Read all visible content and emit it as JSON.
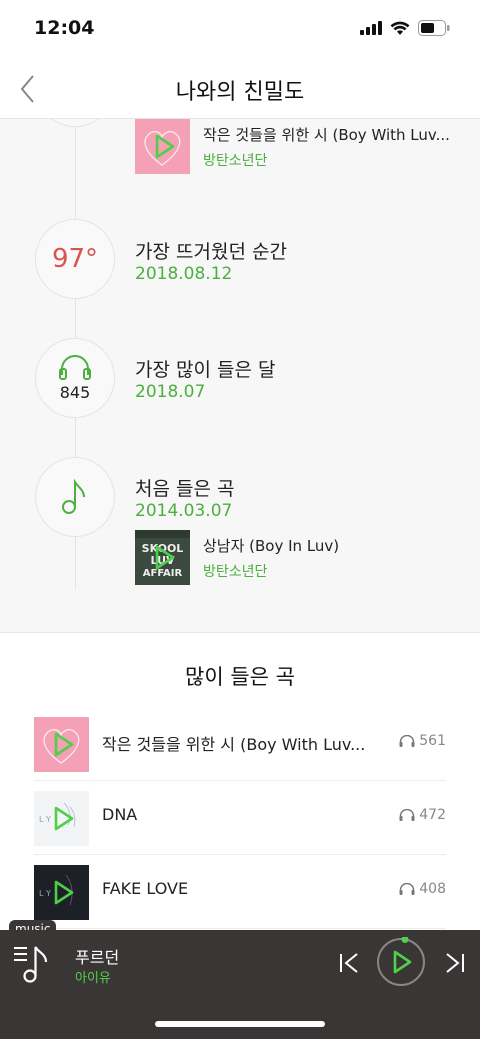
{
  "status": {
    "time": "12:04"
  },
  "header": {
    "title": "나와의 친밀도"
  },
  "timeline": {
    "top_song": {
      "title": "작은 것들을 위한 시 (Boy With Luv...",
      "artist": "방탄소년단"
    },
    "hottest": {
      "degree": "97°",
      "label": "가장 뜨거웠던 순간",
      "date": "2018.08.12"
    },
    "most_month": {
      "count": "845",
      "label": "가장 많이 들은 달",
      "date": "2018.07"
    },
    "first_song": {
      "label": "처음 들은 곡",
      "date": "2014.03.07",
      "song_title": "상남자 (Boy In Luv)",
      "song_artist": "방탄소년단",
      "album_art_text": "SKOOL LUV AFFAIR"
    }
  },
  "most_played": {
    "title": "많이 들은 곡",
    "songs": [
      {
        "title": "작은 것들을 위한 시 (Boy With Luv...",
        "plays": "561"
      },
      {
        "title": "DNA",
        "plays": "472"
      },
      {
        "title": "FAKE LOVE",
        "plays": "408"
      }
    ]
  },
  "player": {
    "tag": "music",
    "title": "푸르던",
    "artist": "아이유"
  },
  "colors": {
    "accent": "#4caf3f",
    "degree": "#d9534f",
    "player_bg": "#3a3636"
  }
}
